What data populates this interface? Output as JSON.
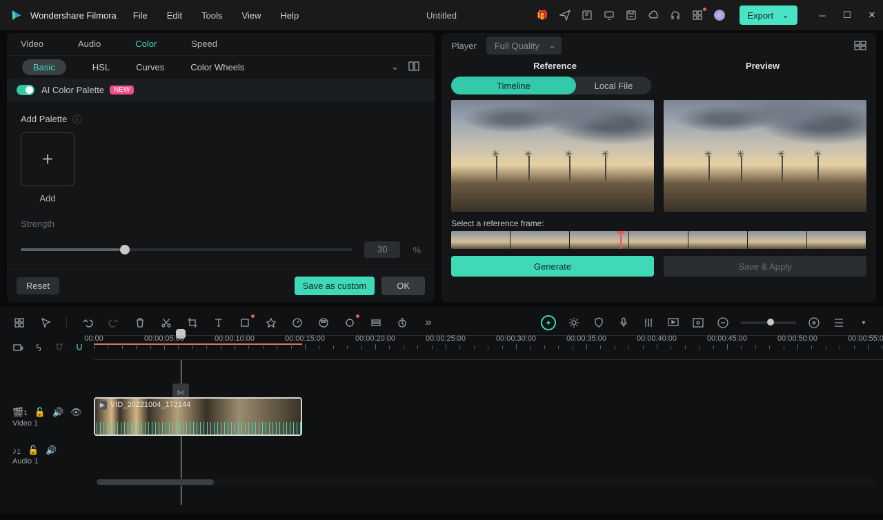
{
  "app": {
    "name": "Wondershare Filmora",
    "doc_title": "Untitled",
    "export_label": "Export"
  },
  "menus": [
    "File",
    "Edit",
    "Tools",
    "View",
    "Help"
  ],
  "left_tabs": {
    "items": [
      "Video",
      "Audio",
      "Color",
      "Speed"
    ],
    "active_index": 2
  },
  "subtabs": {
    "items": [
      "Basic",
      "HSL",
      "Curves",
      "Color Wheels"
    ],
    "active_index": 0
  },
  "ai_palette": {
    "label": "AI Color Palette",
    "new_badge": "NEW"
  },
  "palette": {
    "add_label": "Add Palette",
    "add_box_label": "Add"
  },
  "strength": {
    "label": "Strength",
    "value": "30",
    "unit": "%"
  },
  "left_footer": {
    "reset": "Reset",
    "save": "Save as custom",
    "ok": "OK"
  },
  "player": {
    "label": "Player",
    "quality": "Full Quality"
  },
  "preview": {
    "ref": "Reference",
    "prev": "Preview",
    "tabs": [
      "Timeline",
      "Local File"
    ],
    "select_frame": "Select a reference frame:",
    "generate": "Generate",
    "apply": "Save & Apply"
  },
  "timeline": {
    "ticks": [
      "00:00",
      "00:00:05:00",
      "00:00:10:00",
      "00:00:15:00",
      "00:00:20:00",
      "00:00:25:00",
      "00:00:30:00",
      "00:00:35:00",
      "00:00:40:00",
      "00:00:45:00",
      "00:00:50:00",
      "00:00:55:00"
    ],
    "video_track": {
      "name": "Video 1",
      "clip_name": "VID_20221004_172144"
    },
    "audio_track": {
      "name": "Audio 1"
    }
  }
}
